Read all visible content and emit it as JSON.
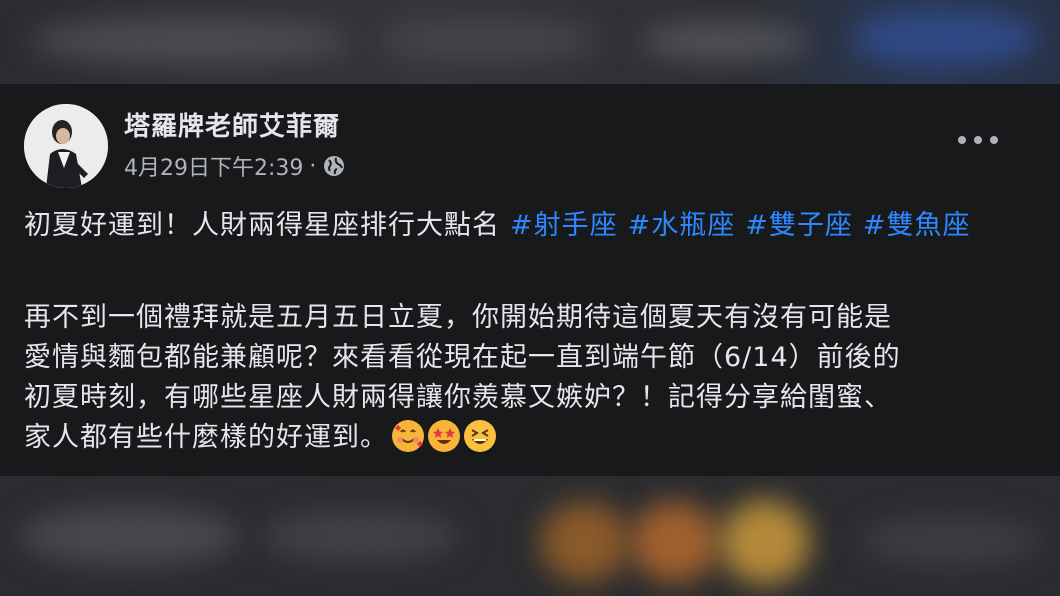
{
  "post": {
    "author": "塔羅牌老師艾菲爾",
    "timestamp": "4月29日下午2:39",
    "separator": "·",
    "privacy_icon": "globe-icon",
    "more_icon": "more-options-icon",
    "headline_text": "初夏好運到！人財兩得星座排行大點名",
    "hashtags": [
      "#射手座",
      "#水瓶座",
      "#雙子座",
      "#雙魚座"
    ],
    "body_lines": [
      "再不到一個禮拜就是五月五日立夏，你開始期待這個夏天有沒有可能是",
      "愛情與麵包都能兼顧呢？來看看從現在起一直到端午節（6/14）前後的",
      "初夏時刻，有哪些星座人財兩得讓你羨慕又嫉妒？！記得分享給閨蜜、",
      "家人都有些什麼樣的好運到。"
    ],
    "emojis": [
      "smiling-face-with-hearts-emoji",
      "star-struck-emoji",
      "grinning-squinting-face-emoji"
    ]
  },
  "colors": {
    "background": "#18191a",
    "text": "#e4e6eb",
    "secondary_text": "#b0b3b8",
    "hashtag": "#2d88ff"
  }
}
